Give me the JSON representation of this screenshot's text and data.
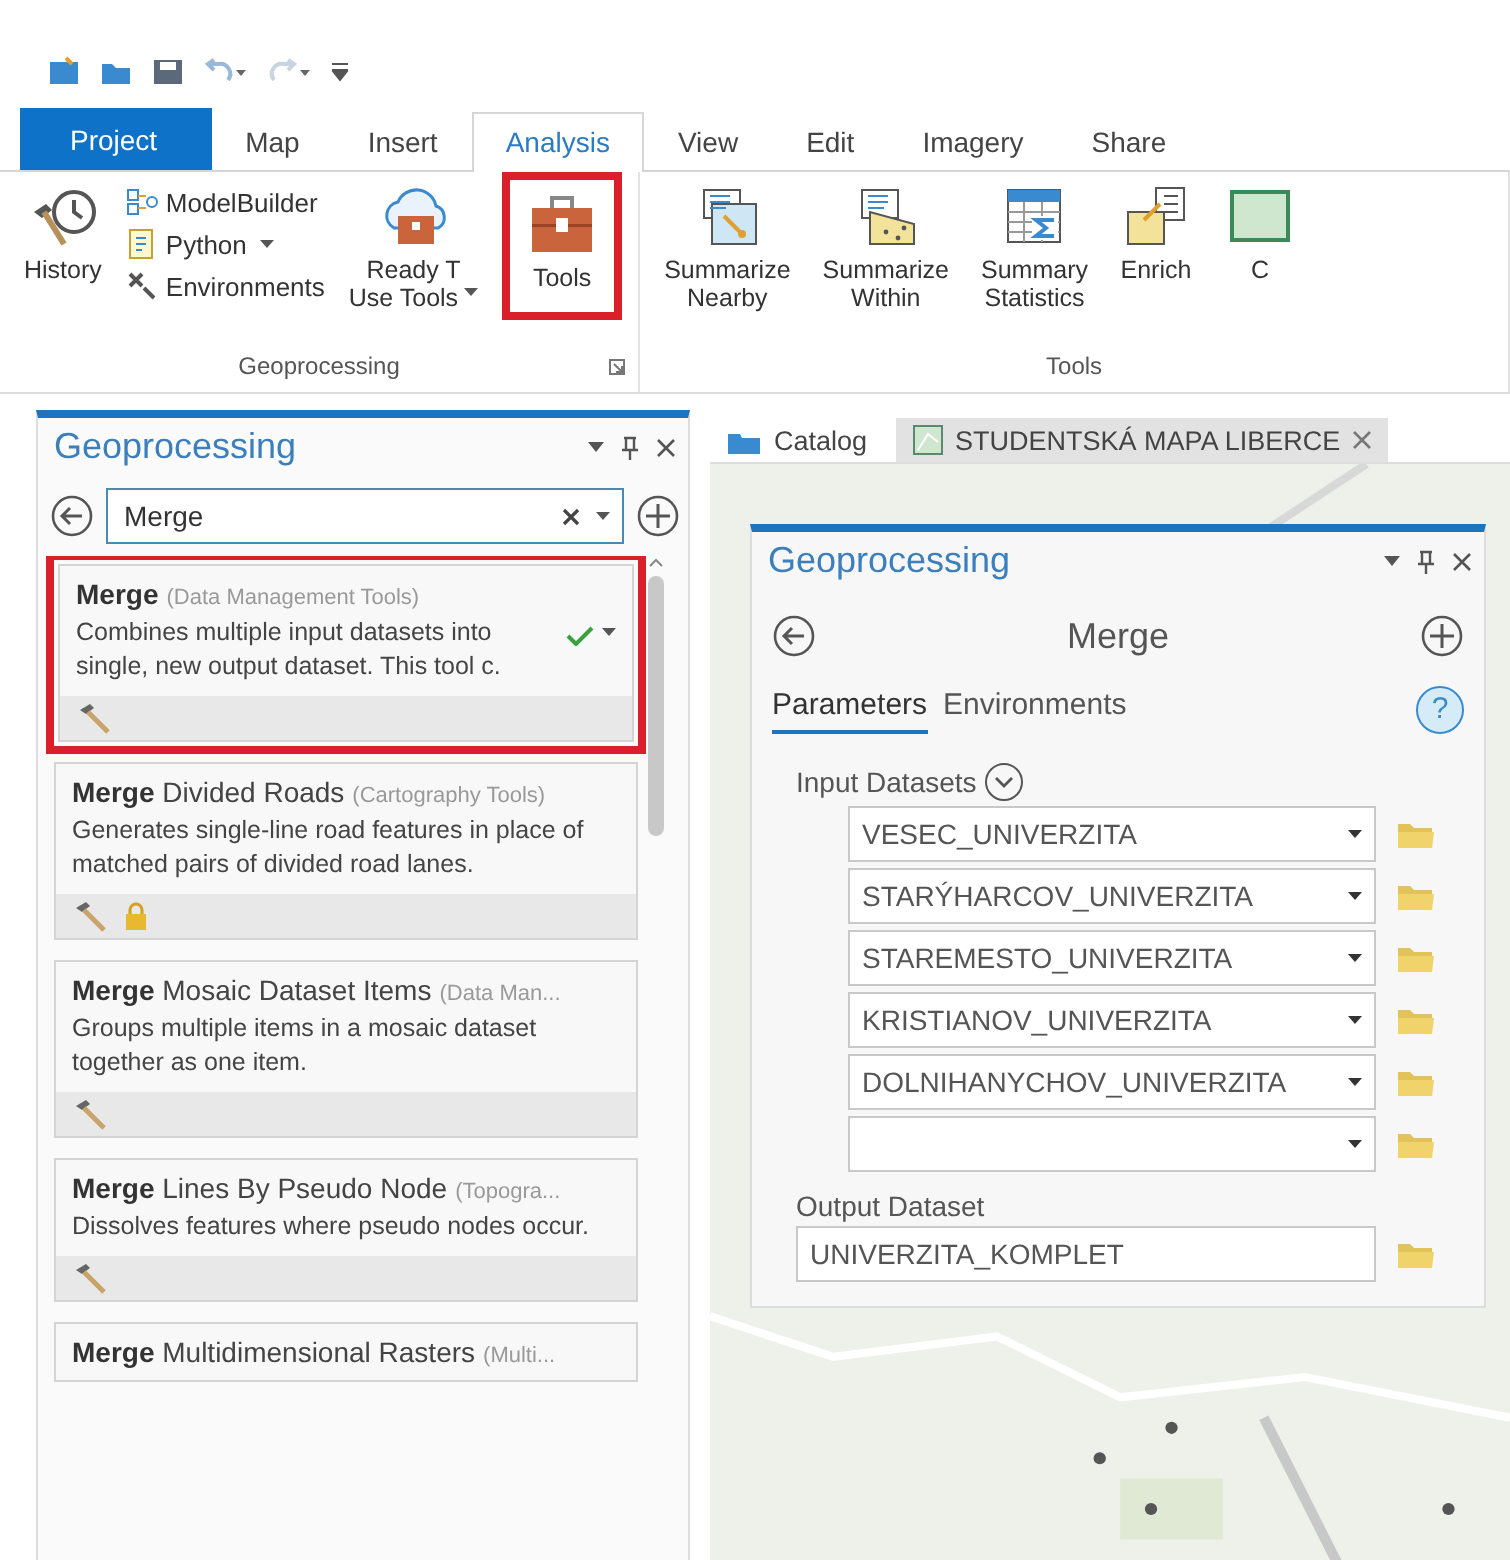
{
  "tabs": [
    {
      "label": "Project",
      "kind": "backstage",
      "selected": false
    },
    {
      "label": "Map",
      "kind": "tab",
      "selected": false
    },
    {
      "label": "Insert",
      "kind": "tab",
      "selected": false
    },
    {
      "label": "Analysis",
      "kind": "tab",
      "selected": true
    },
    {
      "label": "View",
      "kind": "tab",
      "selected": false
    },
    {
      "label": "Edit",
      "kind": "tab",
      "selected": false
    },
    {
      "label": "Imagery",
      "kind": "tab",
      "selected": false
    },
    {
      "label": "Share",
      "kind": "tab",
      "selected": false
    }
  ],
  "ribbon": {
    "groups": [
      {
        "label": "Geoprocessing",
        "launcher": true,
        "items": [
          {
            "kind": "large",
            "lines": [
              "History"
            ],
            "dropdown": false,
            "highlighted": false
          },
          {
            "kind": "stack",
            "items": [
              {
                "label": "ModelBuilder",
                "dropdown": false
              },
              {
                "label": "Python",
                "dropdown": true
              },
              {
                "label": "Environments",
                "dropdown": false
              }
            ]
          },
          {
            "kind": "large",
            "lines": [
              "Ready T",
              "Use Tools"
            ],
            "dropdown": true,
            "highlighted": false
          },
          {
            "kind": "large",
            "lines": [
              "Tools"
            ],
            "dropdown": false,
            "highlighted": true
          }
        ]
      },
      {
        "label": "Tools",
        "launcher": false,
        "items": [
          {
            "kind": "large",
            "lines": [
              "Summarize",
              "Nearby"
            ],
            "dropdown": false,
            "highlighted": false
          },
          {
            "kind": "large",
            "lines": [
              "Summarize",
              "Within"
            ],
            "dropdown": false,
            "highlighted": false
          },
          {
            "kind": "large",
            "lines": [
              "Summary",
              "Statistics"
            ],
            "dropdown": false,
            "highlighted": false
          },
          {
            "kind": "large",
            "lines": [
              "Enrich"
            ],
            "dropdown": false,
            "highlighted": false
          },
          {
            "kind": "large",
            "lines": [
              "C"
            ],
            "dropdown": false,
            "highlighted": false
          }
        ]
      }
    ]
  },
  "left_pane": {
    "title": "Geoprocessing",
    "search": {
      "value": "Merge"
    },
    "results": [
      {
        "title": "**Merge**",
        "category": "(Data Management Tools)",
        "description": "Combines multiple input datasets into single, new output dataset. This tool c.",
        "highlighted": true,
        "locked": false,
        "favorite": true
      },
      {
        "title": "**Merge** Divided Roads",
        "category": "(Cartography Tools)",
        "description": "Generates single-line road features in place of matched pairs of  divided road lanes.",
        "highlighted": false,
        "locked": true,
        "favorite": false
      },
      {
        "title": "**Merge** Mosaic Dataset Items",
        "category": "(Data Man...",
        "description": "Groups multiple items in a mosaic dataset together as one item.",
        "highlighted": false,
        "locked": false,
        "favorite": false
      },
      {
        "title": "**Merge** Lines By Pseudo Node",
        "category": "(Topogra...",
        "description": "Dissolves features where pseudo nodes occur.",
        "highlighted": false,
        "locked": false,
        "favorite": false
      },
      {
        "title": "**Merge** Multidimensional Rasters",
        "category": "(Multi...",
        "highlighted": false
      }
    ]
  },
  "doc_tabs": [
    {
      "label": "Catalog",
      "kind": "catalog",
      "selected": false
    },
    {
      "label": "STUDENTSKÁ MAPA LIBERCE",
      "kind": "map",
      "selected": true
    }
  ],
  "tool_panel": {
    "title": "Geoprocessing",
    "tool": "Merge",
    "tabs": [
      {
        "label": "Parameters",
        "selected": true
      },
      {
        "label": "Environments",
        "selected": false
      }
    ],
    "help": "?",
    "input_label": "Input Datasets",
    "inputs": [
      "VESEC_UNIVERZITA",
      "STARÝHARCOV_UNIVERZITA",
      "STAREMESTO_UNIVERZITA",
      "KRISTIANOV_UNIVERZITA",
      "DOLNIHANYCHOV_UNIVERZITA"
    ],
    "output_label": "Output Dataset",
    "output": "UNIVERZITA_KOMPLET"
  }
}
